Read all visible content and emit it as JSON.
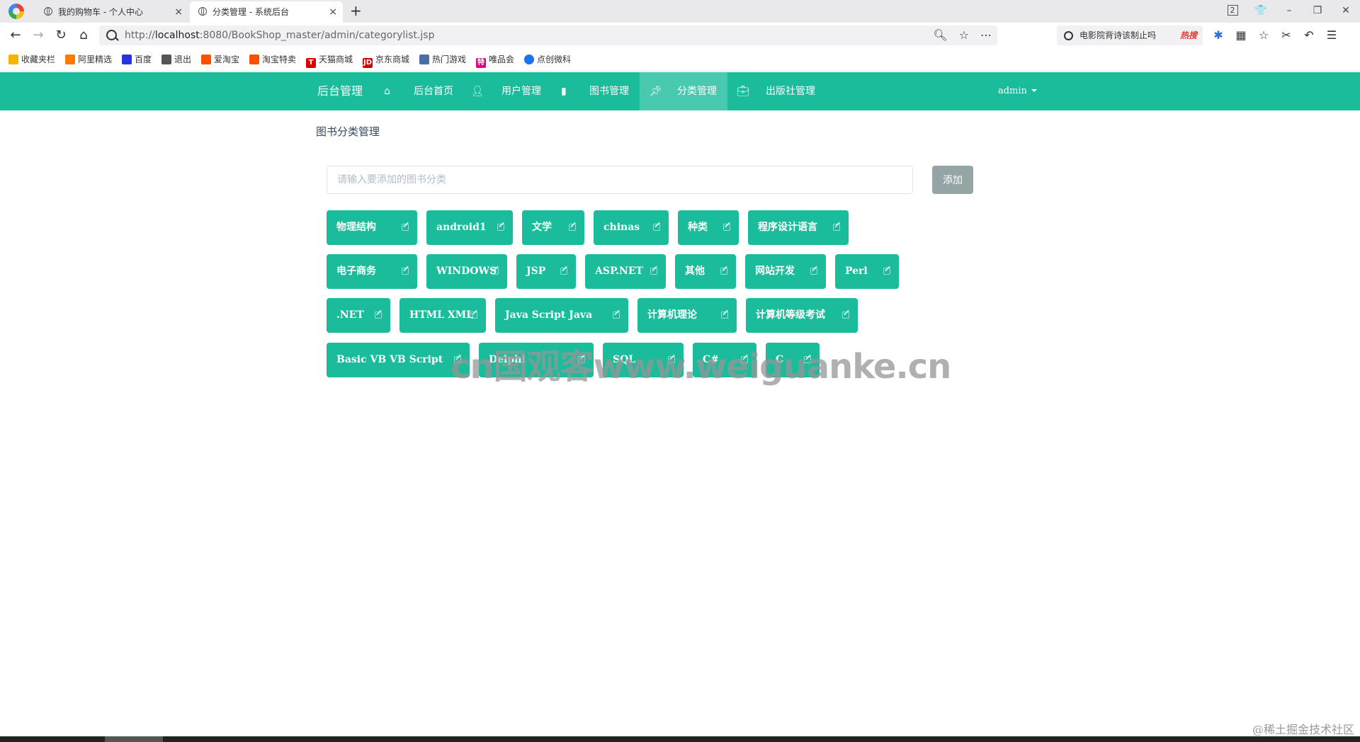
{
  "browser": {
    "tabs": [
      {
        "title": "我的购物车 - 个人中心",
        "close": "×"
      },
      {
        "title": "分类管理 - 系统后台",
        "close": "×"
      }
    ],
    "new_tab": "+",
    "window_controls": {
      "tab_count": "2",
      "minimize": "–",
      "restore": "❐",
      "close": "✕"
    },
    "url": {
      "prefix": "http://",
      "host": "localhost",
      "rest": ":8080/BookShop_master/admin/categorylist.jsp"
    },
    "hot_search": {
      "text": "电影院背诗该制止吗",
      "badge": "热搜"
    },
    "bookmarks": [
      "收藏夹栏",
      "阿里精选",
      "百度",
      "退出",
      "爱淘宝",
      "淘宝特卖",
      "天猫商城",
      "京东商城",
      "热门游戏",
      "唯品会",
      "点创微科"
    ]
  },
  "navbar": {
    "brand": "后台管理",
    "items": [
      {
        "label": "后台首页",
        "icon": "home-icon"
      },
      {
        "label": "用户管理",
        "icon": "user-icon"
      },
      {
        "label": "图书管理",
        "icon": "book-icon"
      },
      {
        "label": "分类管理",
        "icon": "pushpin-icon"
      },
      {
        "label": "出版社管理",
        "icon": "briefcase-icon"
      }
    ],
    "user": "admin"
  },
  "colors": {
    "primary": "#1abc9c",
    "active": "#48c9b0",
    "add_button": "#95a5a6",
    "heading": "#34495e"
  },
  "main": {
    "heading": "图书分类管理",
    "input_placeholder": "请输入要添加的图书分类",
    "add_label": "添加",
    "categories": [
      [
        "物理结构",
        "android1",
        "文学",
        "chinas",
        "种类",
        "程序设计语言"
      ],
      [
        "电子商务",
        "WINDOWS",
        "JSP",
        "ASP.NET",
        "其他",
        "网站开发",
        "Perl"
      ],
      [
        ".NET",
        "HTML XML",
        "Java Script Java",
        "计算机理论",
        "计算机等级考试"
      ],
      [
        "Basic VB VB Script",
        "Delphi",
        "SQL",
        "C#",
        "C"
      ]
    ]
  },
  "watermark": "cn国观客www.weiguanke.cn",
  "footer_mark": "@稀土掘金技术社区"
}
